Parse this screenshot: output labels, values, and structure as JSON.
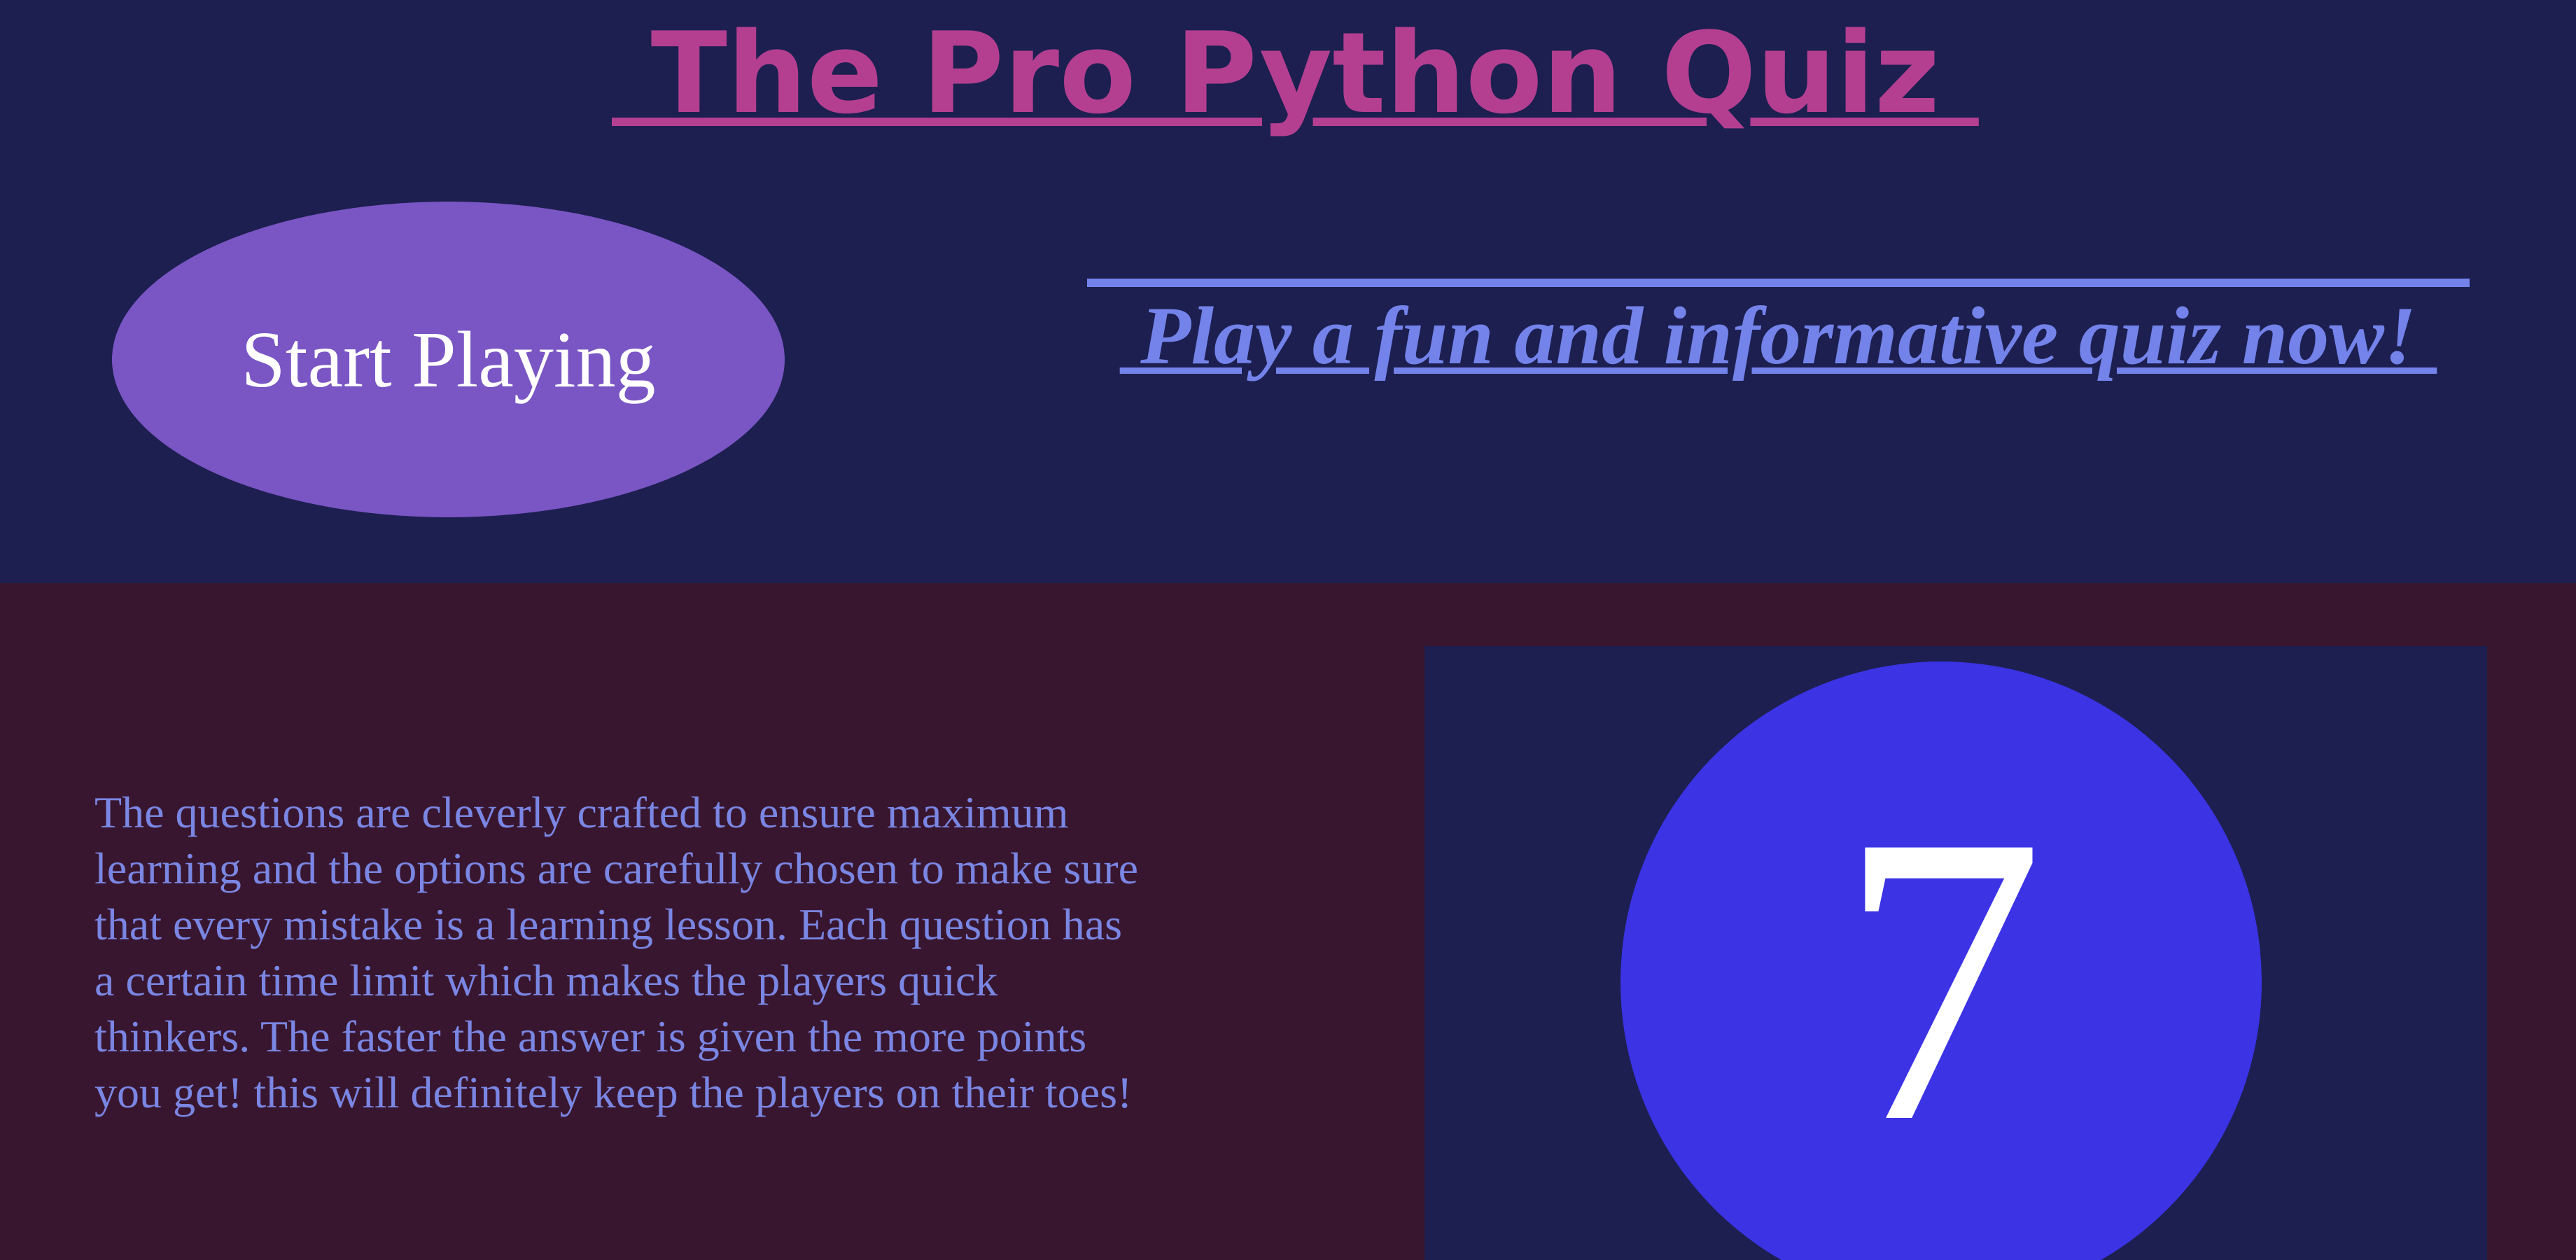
{
  "header": {
    "title": " The Pro Python Quiz ",
    "start_button_label": "Start Playing",
    "tagline": " Play a fun and informative quiz now! "
  },
  "info": {
    "description": "The questions are cleverly crafted to ensure maximum learning and the options are carefully chosen to make sure that every mistake is a learning lesson. Each question has a certain time limit which makes the players quick thinkers. The faster the answer is given the more points you get! this will definitely keep the players on their toes!"
  },
  "timer": {
    "value": "7"
  },
  "colors": {
    "page_background": "#1c1f4f",
    "info_background": "#39162f",
    "title": "#b43f91",
    "start_button": "#7a55c4",
    "tagline": "#7483ea",
    "description_text": "#7a86e3",
    "timer_circle": "#3b33e4"
  }
}
